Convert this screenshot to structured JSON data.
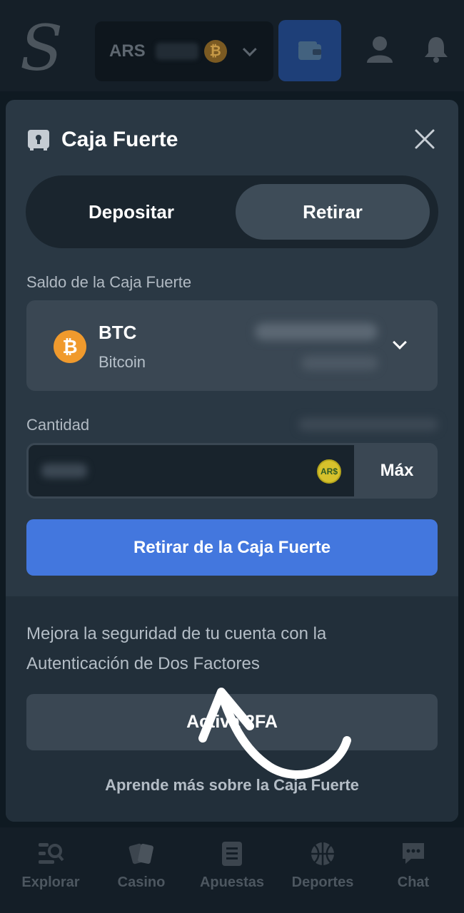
{
  "topbar": {
    "logo": "S",
    "currency": "ARS",
    "coin_symbol": "₿"
  },
  "modal": {
    "title": "Caja Fuerte",
    "tabs": [
      {
        "label": "Depositar",
        "active": false
      },
      {
        "label": "Retirar",
        "active": true
      }
    ],
    "balance_label": "Saldo de la Caja Fuerte",
    "currency_select": {
      "code": "BTC",
      "name": "Bitcoin",
      "coin_symbol": "₿"
    },
    "amount_label": "Cantidad",
    "amount_currency": "AR$",
    "max_label": "Máx",
    "withdraw_button": "Retirar de la Caja Fuerte",
    "twofa_text": "Mejora la seguridad de tu cuenta con la Autenticación de Dos Factores",
    "twofa_button": "Activa 2FA",
    "learn_more": "Aprende más sobre la Caja Fuerte"
  },
  "bottom_nav": [
    {
      "label": "Explorar"
    },
    {
      "label": "Casino"
    },
    {
      "label": "Apuestas"
    },
    {
      "label": "Deportes"
    },
    {
      "label": "Chat"
    }
  ],
  "colors": {
    "primary": "#4377de",
    "bitcoin": "#f09a2d",
    "modal_bg": "#2a3844"
  }
}
